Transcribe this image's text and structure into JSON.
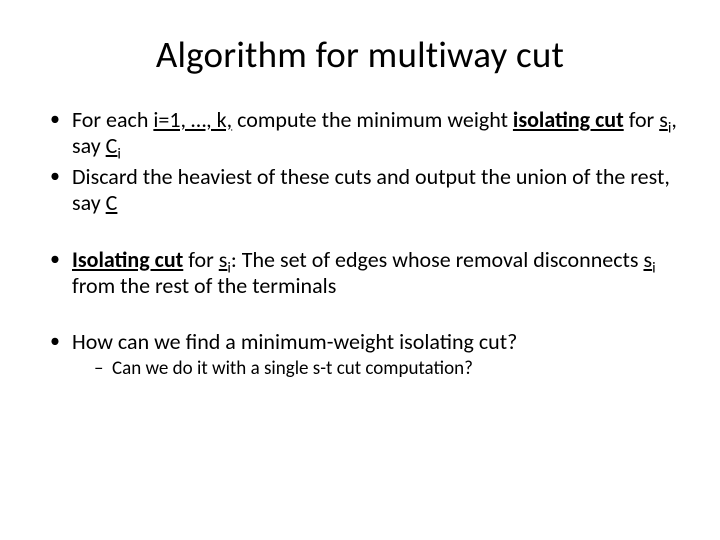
{
  "title": "Algorithm for multiway cut",
  "b1": {
    "t1": "For each ",
    "u1": "i=1, …, k,",
    "t2": " compute the minimum weight ",
    "bu1": "isolating cut",
    "t3": " for ",
    "v1a": "s",
    "v1b": "i",
    "t4": ", say ",
    "v2a": "C",
    "v2b": "i"
  },
  "b2": {
    "t1": "Discard the heaviest of these cuts and output the union of the rest, say ",
    "v1": "C"
  },
  "b3": {
    "bu1": "Isolating cut",
    "t1": " for ",
    "v1a": "s",
    "v1b": "i",
    "t2": ":  The set of edges whose removal disconnects ",
    "v2a": "s",
    "v2b": "i ",
    "t3": "from the rest of the terminals"
  },
  "b4": {
    "t1": "How can we find a minimum-weight isolating cut?",
    "sub1": "Can we do it with a single s-t cut computation?"
  }
}
